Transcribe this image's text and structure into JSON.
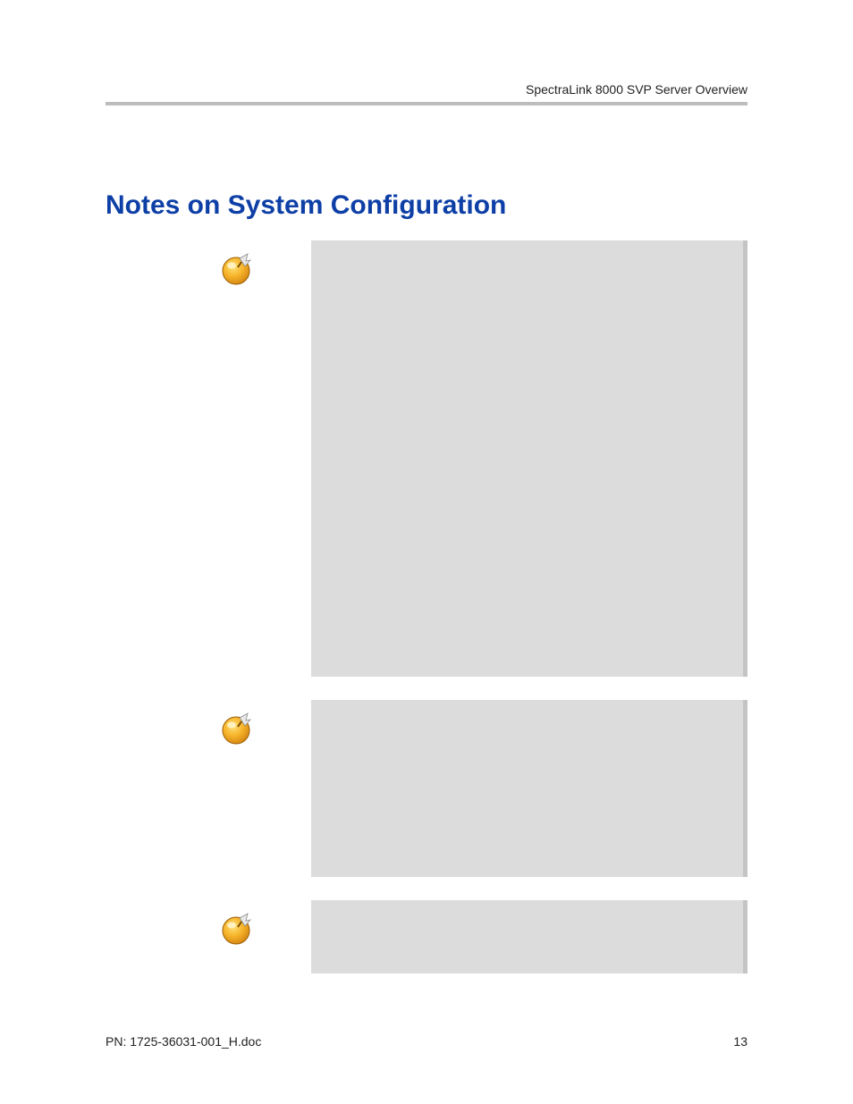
{
  "header": {
    "running_title": "SpectraLink 8000 SVP Server Overview"
  },
  "heading": "Notes on System Configuration",
  "icons": {
    "note": "pushpin-icon"
  },
  "colors": {
    "heading": "#0d3fa6",
    "note_bg": "#dcdcdc",
    "note_edge": "#c4c4c4",
    "rule": "#bdbdbd"
  },
  "footer": {
    "pn_label": "PN: 1725-36031-001_H.doc",
    "page_number": "13"
  }
}
